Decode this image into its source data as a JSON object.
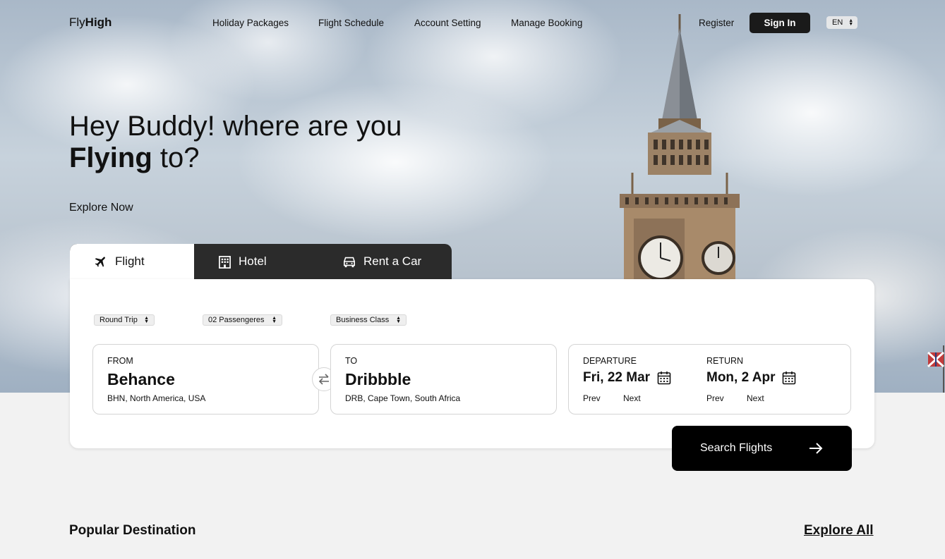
{
  "brand": {
    "logo_light": "Fly",
    "logo_bold": "High"
  },
  "nav": {
    "links": [
      "Holiday Packages",
      "Flight Schedule",
      "Account Setting",
      "Manage Booking"
    ],
    "register": "Register",
    "sign_in": "Sign In",
    "language": "EN"
  },
  "hero": {
    "line1": "Hey Buddy! where are you",
    "line2_bold": "Flying",
    "line2_rest": " to?",
    "explore": "Explore Now"
  },
  "tabs": [
    {
      "label": "Flight",
      "icon": "plane-icon",
      "active": true
    },
    {
      "label": "Hotel",
      "icon": "building-icon",
      "active": false
    },
    {
      "label": "Rent a Car",
      "icon": "car-icon",
      "active": false
    }
  ],
  "options": {
    "trip_type": "Round Trip",
    "passengers": "02 Passengeres",
    "cabin_class": "Business Class"
  },
  "from": {
    "label": "FROM",
    "city": "Behance",
    "detail": "BHN, North America, USA"
  },
  "to": {
    "label": "TO",
    "city": "Dribbble",
    "detail": "DRB, Cape Town, South Africa"
  },
  "departure": {
    "label": "DEPARTURE",
    "date": "Fri, 22 Mar",
    "prev": "Prev",
    "next": "Next"
  },
  "return": {
    "label": "RETURN",
    "date": "Mon, 2 Apr",
    "prev": "Prev",
    "next": "Next"
  },
  "search_button": "Search Flights",
  "popular": {
    "title": "Popular Destination",
    "explore_all": "Explore All"
  },
  "colors": {
    "primary_dark": "#1a1a1a",
    "tab_bar": "#2b2b2b",
    "background": "#f2f2f2"
  }
}
